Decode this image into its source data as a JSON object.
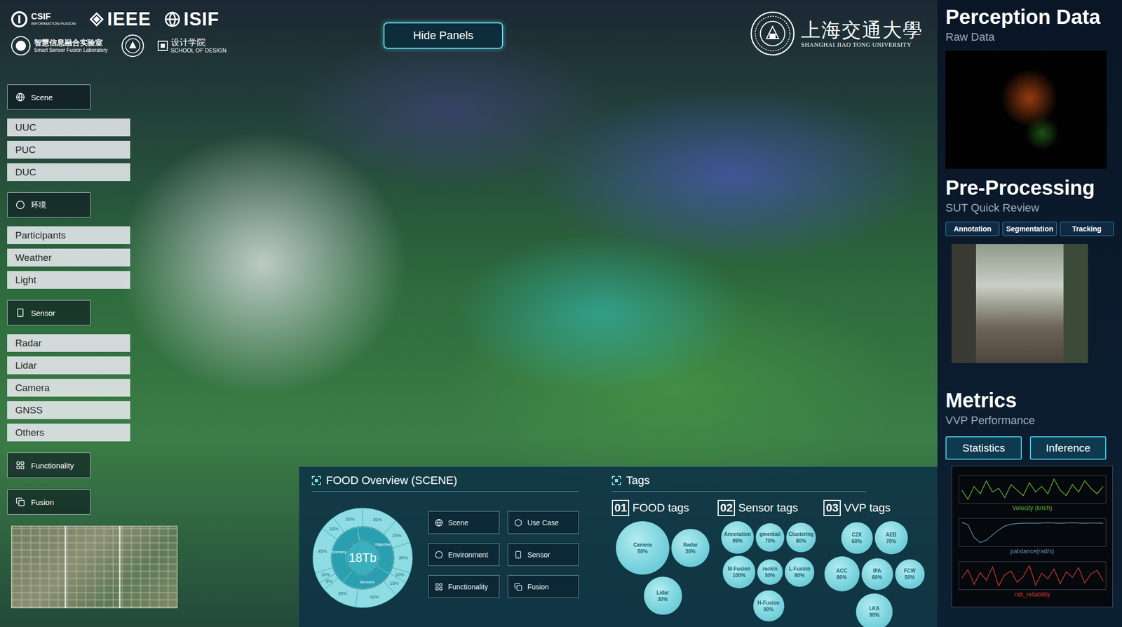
{
  "logos": {
    "csif": "CSIF",
    "csif_caption": "INFORMATION FUSION",
    "ieee": "IEEE",
    "isif": "ISIF",
    "lab_name": "智慧信息融合实验室",
    "lab_caption": "Smart Sensor Fusion Laboratory",
    "school_name": "设计学院",
    "school_caption": "SCHOOL OF DESIGN"
  },
  "hide_panels": "Hide Panels",
  "university": {
    "name": "上海交通大學",
    "caption": "SHANGHAI JIAO TONG UNIVERSITY"
  },
  "sidebar": {
    "sections": [
      {
        "label": "Scene",
        "items": [
          "UUC",
          "PUC",
          "DUC"
        ]
      },
      {
        "label": "环境",
        "items": [
          "Participants",
          "Weather",
          "Light"
        ]
      },
      {
        "label": "Sensor",
        "items": [
          "Radar",
          "Lidar",
          "Camera",
          "GNSS",
          "Others"
        ]
      },
      {
        "label": "Functionality",
        "items": []
      },
      {
        "label": "Fusion",
        "items": []
      }
    ]
  },
  "overview": {
    "title": "FOOD Overview (SCENE)",
    "donut": {
      "center": "18Tb",
      "inner": [
        {
          "label": "Objective",
          "value": 1.2
        },
        {
          "label": "Sensors",
          "value": 0.9
        },
        {
          "label": "Scenery",
          "value": 1.2
        }
      ],
      "outer": [
        {
          "reading": "35%",
          "value": 35
        },
        {
          "reading": "25%",
          "value": 25
        },
        {
          "reading": "30%",
          "value": 30
        },
        {
          "reading": "10%",
          "value": 10
        },
        {
          "reading": "15%",
          "value": 15
        },
        {
          "reading": "42%",
          "value": 42
        },
        {
          "reading": "35%",
          "value": 35
        },
        {
          "reading": "8%",
          "value": 8
        },
        {
          "reading": "10%",
          "value": 10
        },
        {
          "reading": "45%",
          "value": 45
        },
        {
          "reading": "15%",
          "value": 15
        },
        {
          "reading": "30%",
          "value": 30
        }
      ]
    },
    "buttons": [
      "Scene",
      "Use Case",
      "Environment",
      "Sensor",
      "Functionality",
      "Fusion"
    ]
  },
  "tags": {
    "title": "Tags",
    "groups": [
      {
        "number": "01",
        "title": "FOOD tags",
        "bubbles": [
          {
            "label": "Camera",
            "reading": "50%",
            "level": 0.5
          },
          {
            "label": "Radar",
            "reading": "30%",
            "level": 0.3
          },
          {
            "label": "Lidar",
            "reading": "30%",
            "level": 0.3
          }
        ]
      },
      {
        "number": "02",
        "title": "Sensor tags",
        "bubbles": [
          {
            "label": "Annotation",
            "reading": "99%",
            "level": 0.99
          },
          {
            "label": "gmentati",
            "reading": "70%",
            "level": 0.7
          },
          {
            "label": "Clustering",
            "reading": "80%",
            "level": 0.8
          },
          {
            "label": "M-Fusion",
            "reading": "100%",
            "level": 1.0
          },
          {
            "label": "rackin",
            "reading": "50%",
            "level": 0.5
          },
          {
            "label": "L-Fusion",
            "reading": "80%",
            "level": 0.8
          },
          {
            "label": "H-Fusion",
            "reading": "90%",
            "level": 0.9
          }
        ]
      },
      {
        "number": "03",
        "title": "VVP tags",
        "bubbles": [
          {
            "label": "C2X",
            "reading": "60%",
            "level": 0.6
          },
          {
            "label": "AEB",
            "reading": "70%",
            "level": 0.7
          },
          {
            "label": "ACC",
            "reading": "80%",
            "level": 0.8
          },
          {
            "label": "IPA",
            "reading": "60%",
            "level": 0.6
          },
          {
            "label": "FCW",
            "reading": "50%",
            "level": 0.5
          },
          {
            "label": "LKA",
            "reading": "90%",
            "level": 0.9
          }
        ]
      }
    ]
  },
  "panel": {
    "perception": {
      "title": "Perception Data",
      "subtitle": "Raw Data"
    },
    "preprocessing": {
      "title": "Pre-Processing",
      "subtitle": "SUT Quick Review",
      "buttons": [
        "Annotation",
        "Segmentation",
        "Tracking"
      ]
    },
    "metrics": {
      "title": "Metrics",
      "subtitle": "VVP Performance",
      "buttons": [
        "Statistics",
        "Inference"
      ],
      "charts": [
        {
          "label": "Velocity (km/h)",
          "color": "#5fae3a",
          "values": [
            21,
            20.5,
            21.2,
            20.8,
            21.5,
            20.9,
            21.1,
            20.6,
            21.3,
            21.0,
            20.7,
            21.4,
            20.9,
            21.2,
            20.8,
            21.6,
            21.0,
            20.7,
            21.3,
            20.9,
            21.5,
            21.1,
            20.8,
            21.2
          ]
        },
        {
          "label": "palstance(rad/s)",
          "color": "#5f88a8",
          "values": [
            0.2,
            0.1,
            -0.4,
            -0.6,
            -0.5,
            -0.3,
            -0.1,
            0.05,
            0.12,
            0.15,
            0.16,
            0.17,
            0.16,
            0.17,
            0.18,
            0.17,
            0.16,
            0.17,
            0.18,
            0.17,
            0.16,
            0.17,
            0.17,
            0.16
          ]
        },
        {
          "label": "ndt_reliability",
          "color": "#c0392b",
          "values": [
            0.5,
            0.62,
            0.41,
            0.58,
            0.47,
            0.66,
            0.39,
            0.55,
            0.6,
            0.44,
            0.52,
            0.68,
            0.4,
            0.57,
            0.49,
            0.63,
            0.42,
            0.59,
            0.51,
            0.65,
            0.43,
            0.56,
            0.61,
            0.46
          ]
        }
      ]
    }
  }
}
